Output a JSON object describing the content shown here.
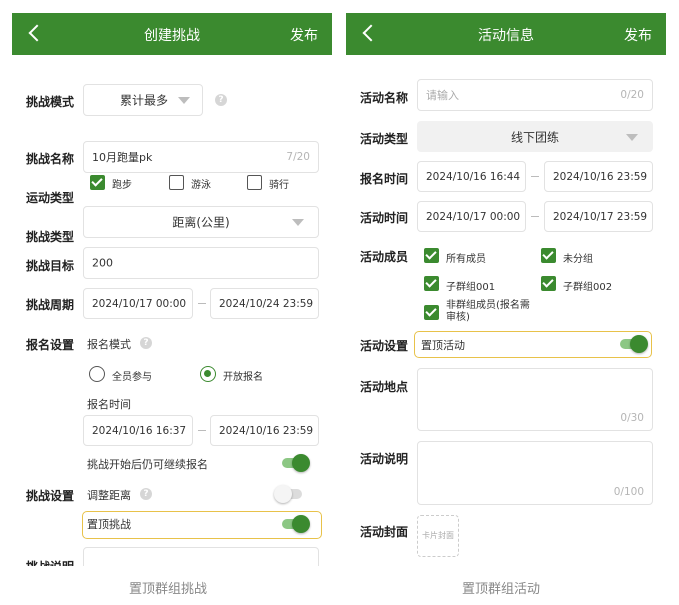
{
  "left": {
    "title": "创建挑战",
    "publish": "发布",
    "mode_label": "挑战模式",
    "mode_value": "累计最多",
    "name_label": "挑战名称",
    "name_value": "10月跑量pk",
    "name_count": "7/20",
    "sport_label": "运动类型",
    "sports": [
      {
        "label": "跑步",
        "checked": true
      },
      {
        "label": "游泳",
        "checked": false
      },
      {
        "label": "骑行",
        "checked": false
      }
    ],
    "type_label": "挑战类型",
    "type_value": "距离(公里)",
    "target_label": "挑战目标",
    "target_value": "200",
    "period_label": "挑战周期",
    "period_start": "2024/10/17 00:00",
    "period_end": "2024/10/24 23:59",
    "signup_label": "报名设置",
    "signup_mode_label": "报名模式",
    "signup_options": [
      {
        "label": "全员参与",
        "selected": false
      },
      {
        "label": "开放报名",
        "selected": true
      }
    ],
    "signup_time_label": "报名时间",
    "signup_start": "2024/10/16 16:37",
    "signup_end": "2024/10/16 23:59",
    "continue_label": "挑战开始后仍可继续报名",
    "continue_on": true,
    "challenge_setting_label": "挑战设置",
    "adjust_label": "调整距离",
    "adjust_on": false,
    "pin_label": "置顶挑战",
    "pin_on": true,
    "desc_label": "挑战说明",
    "caption": "置顶群组挑战"
  },
  "right": {
    "title": "活动信息",
    "publish": "发布",
    "name_label": "活动名称",
    "name_placeholder": "请输入",
    "name_count": "0/20",
    "type_label": "活动类型",
    "type_value": "线下团练",
    "signup_time_label": "报名时间",
    "signup_start": "2024/10/16 16:44",
    "signup_end": "2024/10/16 23:59",
    "activity_time_label": "活动时间",
    "activity_start": "2024/10/17 00:00",
    "activity_end": "2024/10/17 23:59",
    "members_label": "活动成员",
    "members": [
      {
        "label": "所有成员",
        "checked": true
      },
      {
        "label": "未分组",
        "checked": true
      },
      {
        "label": "子群组001",
        "checked": true
      },
      {
        "label": "子群组002",
        "checked": true
      },
      {
        "label": "非群组成员(报名需审核)",
        "checked": true
      }
    ],
    "setting_label": "活动设置",
    "pin_label": "置顶活动",
    "pin_on": true,
    "location_label": "活动地点",
    "location_count": "0/30",
    "desc_label": "活动说明",
    "desc_count": "0/100",
    "cover_label": "活动封面",
    "cover_placeholder": "卡片封面",
    "caption": "置顶群组活动"
  },
  "colors": {
    "brand": "#3b8a2f",
    "highlight": "#e8c24a"
  }
}
